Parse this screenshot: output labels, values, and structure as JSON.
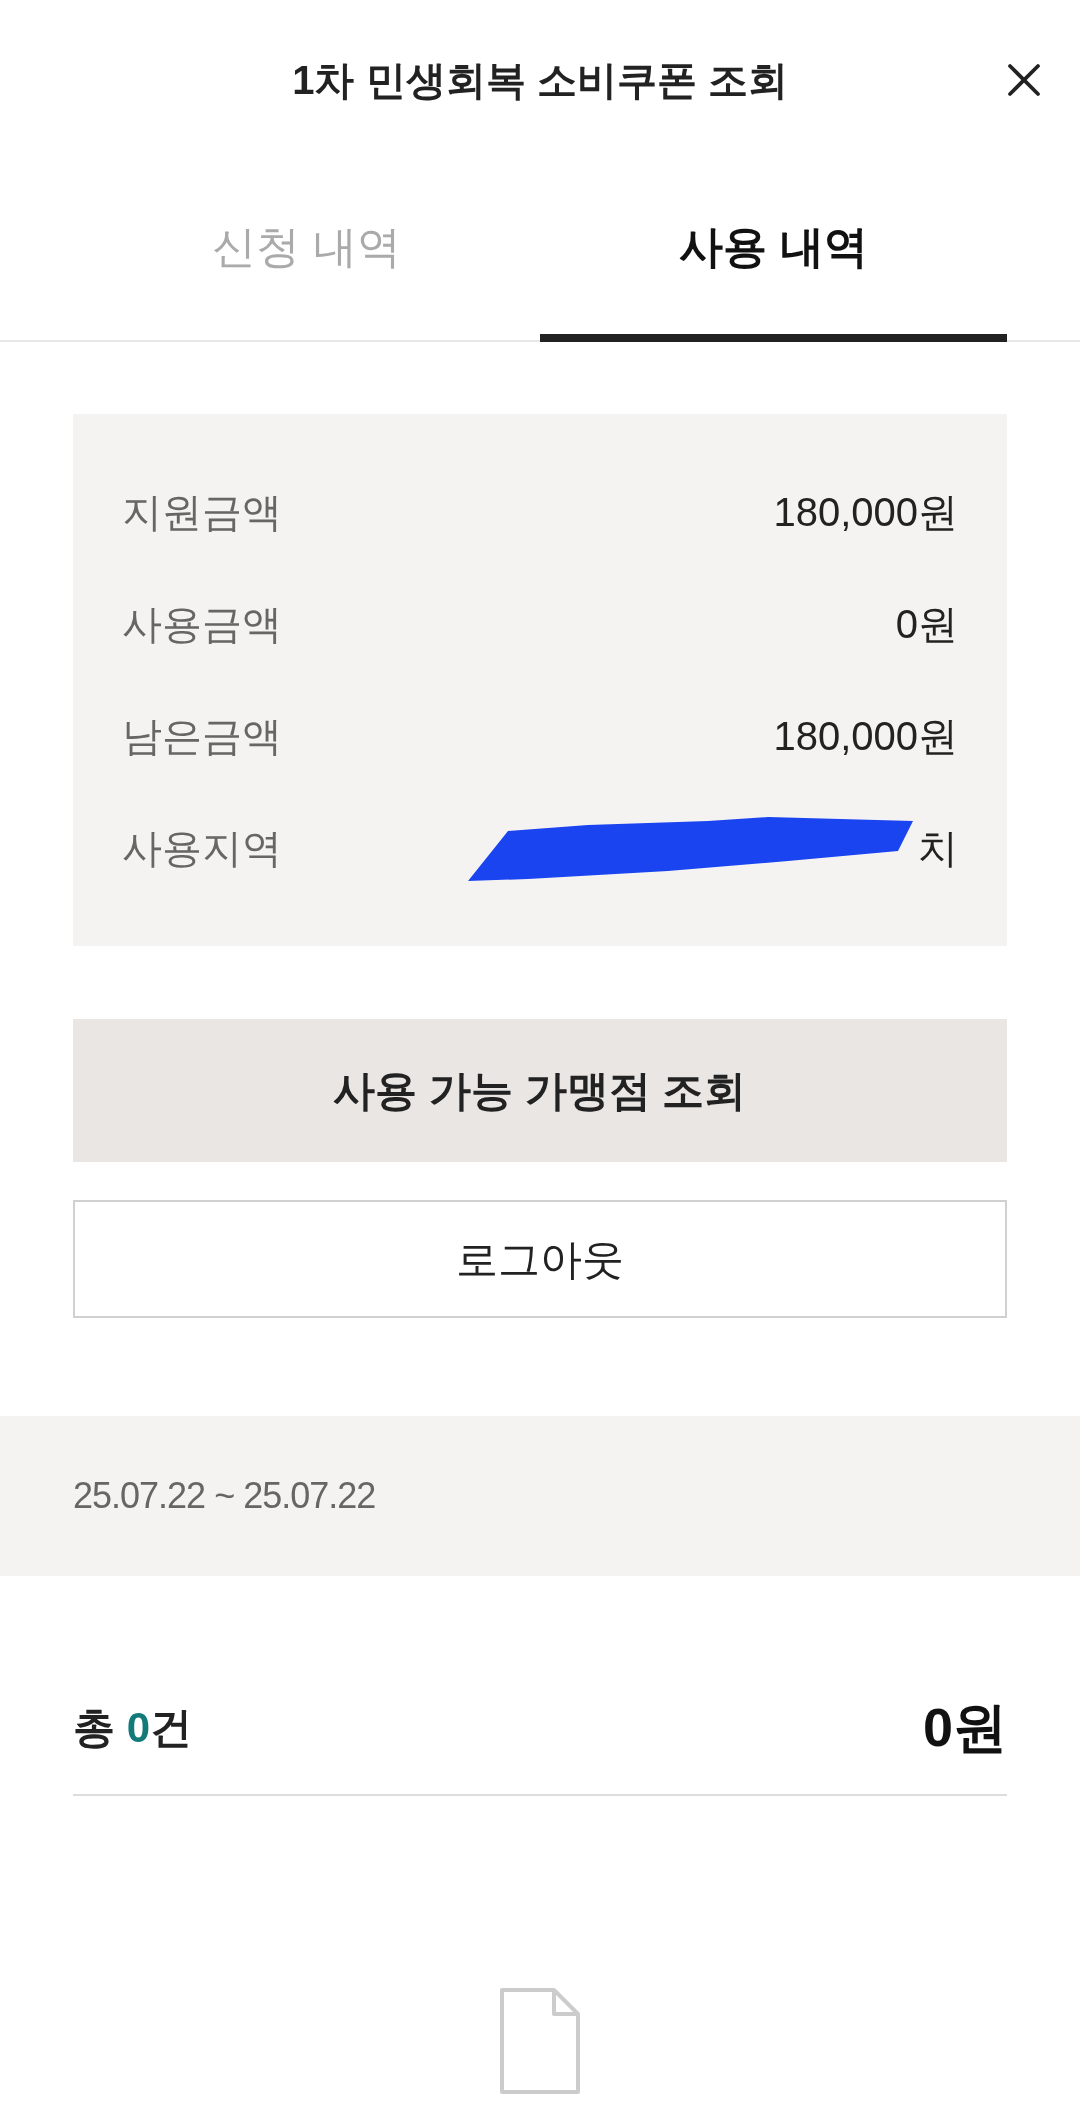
{
  "header": {
    "title": "1차 민생회복 소비쿠폰 조회"
  },
  "tabs": [
    {
      "label": "신청 내역",
      "selected": false
    },
    {
      "label": "사용 내역",
      "selected": true
    }
  ],
  "summary": [
    {
      "label": "지원금액",
      "value": "180,000원",
      "redacted": false
    },
    {
      "label": "사용금액",
      "value": "0원",
      "redacted": false
    },
    {
      "label": "남은금액",
      "value": "180,000원",
      "redacted": false
    },
    {
      "label": "사용지역",
      "value": "치",
      "redacted": true
    }
  ],
  "buttons": [
    {
      "label": "사용 가능 가맹점 조회",
      "kind": "filled"
    },
    {
      "label": "로그아웃",
      "kind": "outline"
    }
  ],
  "period": "25.07.22 ~ 25.07.22",
  "total": {
    "prefix": "총 ",
    "count": "0",
    "suffix": "건",
    "amount": "0원"
  }
}
